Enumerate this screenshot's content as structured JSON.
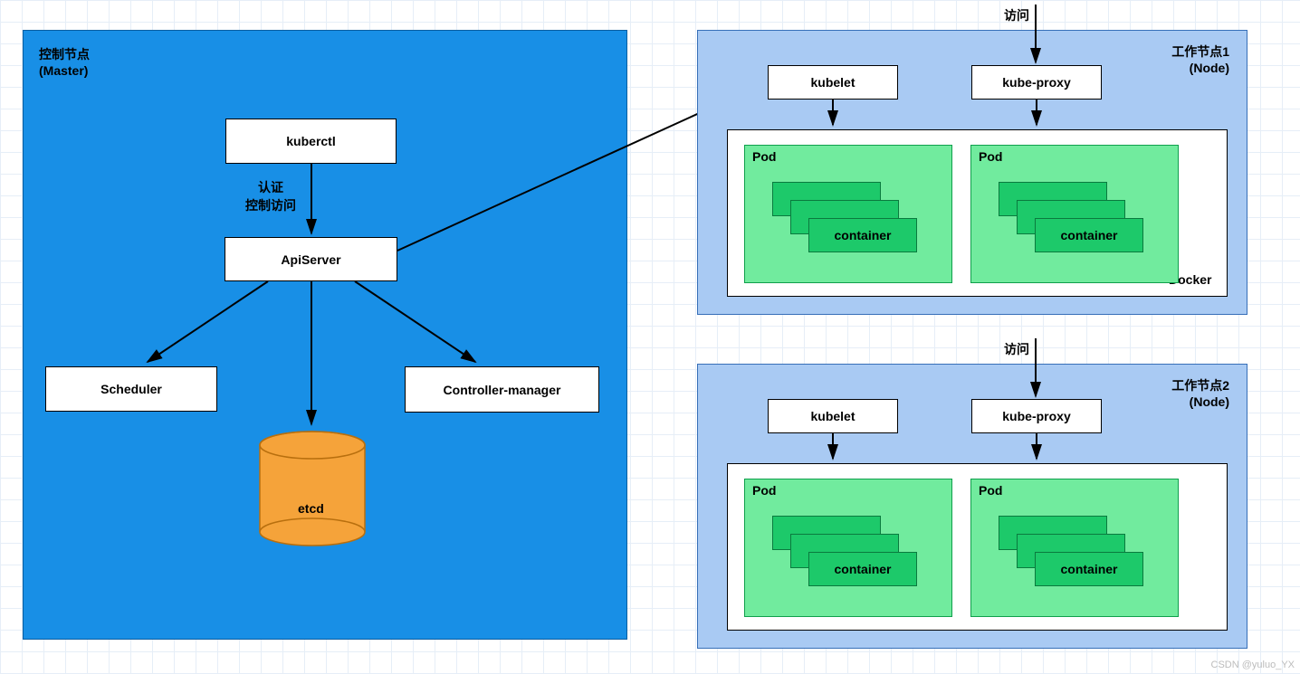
{
  "master": {
    "title_line1": "控制节点",
    "title_line2": "(Master)",
    "kuberctl": "kuberctl",
    "auth_line1": "认证",
    "auth_line2": "控制访问",
    "apiserver": "ApiServer",
    "scheduler": "Scheduler",
    "controller_manager": "Controller-manager",
    "etcd": "etcd"
  },
  "node1": {
    "access": "访问",
    "title_line1": "工作节点1",
    "title_line2": "(Node)",
    "kubelet": "kubelet",
    "kubeproxy": "kube-proxy",
    "docker": "Docker",
    "pod": "Pod",
    "container": "container"
  },
  "node2": {
    "access": "访问",
    "title_line1": "工作节点2",
    "title_line2": "(Node)",
    "kubelet": "kubelet",
    "kubeproxy": "kube-proxy",
    "pod": "Pod",
    "container": "container"
  },
  "watermark": "CSDN @yuluo_YX"
}
